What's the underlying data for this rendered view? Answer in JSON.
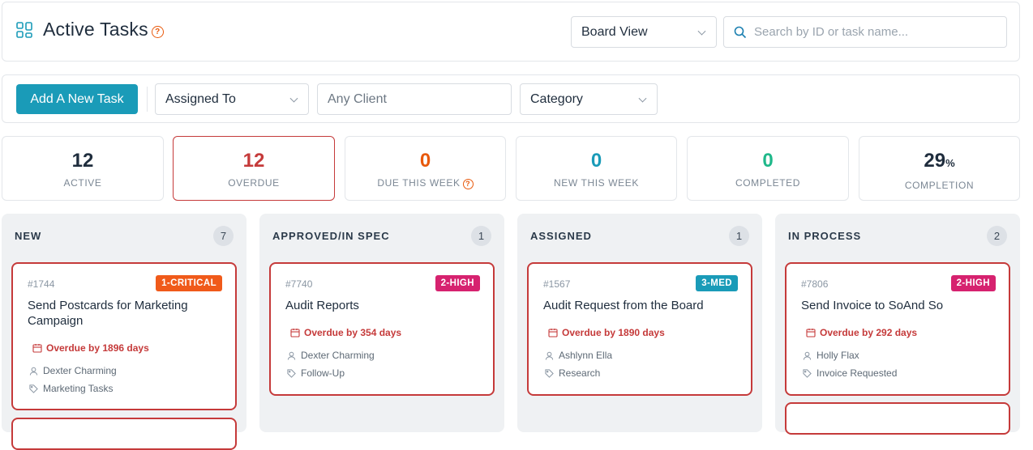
{
  "header": {
    "title": "Active Tasks",
    "view_select": "Board View",
    "search_placeholder": "Search by ID or task name..."
  },
  "filters": {
    "add_button": "Add A New Task",
    "assigned_to": "Assigned To",
    "client": "Any Client",
    "category": "Category"
  },
  "stats": [
    {
      "value": "12",
      "label": "ACTIVE",
      "color": "#1f2d3d"
    },
    {
      "value": "12",
      "label": "OVERDUE",
      "color": "#c53a3a"
    },
    {
      "value": "0",
      "label": "DUE THIS WEEK",
      "color": "#e8590c"
    },
    {
      "value": "0",
      "label": "NEW THIS WEEK",
      "color": "#1a9bb8"
    },
    {
      "value": "0",
      "label": "COMPLETED",
      "color": "#1fb88a"
    },
    {
      "value": "29",
      "unit": "%",
      "label": "COMPLETION",
      "color": "#1f2d3d"
    }
  ],
  "columns": [
    {
      "title": "NEW",
      "count": "7",
      "cards": [
        {
          "id": "#1744",
          "priority": "1-CRITICAL",
          "priority_color": "#f05a1a",
          "title": "Send Postcards for Marketing Campaign",
          "overdue": "Overdue by 1896 days",
          "assignee": "Dexter Charming",
          "tag": "Marketing Tasks"
        }
      ]
    },
    {
      "title": "APPROVED/IN SPEC",
      "count": "1",
      "cards": [
        {
          "id": "#7740",
          "priority": "2-HIGH",
          "priority_color": "#d6226f",
          "title": "Audit Reports",
          "overdue": "Overdue by 354 days",
          "assignee": "Dexter Charming",
          "tag": "Follow-Up"
        }
      ]
    },
    {
      "title": "ASSIGNED",
      "count": "1",
      "cards": [
        {
          "id": "#1567",
          "priority": "3-MED",
          "priority_color": "#1a9bb8",
          "title": "Audit Request from the Board",
          "overdue": "Overdue by 1890 days",
          "assignee": "Ashlynn Ella",
          "tag": "Research"
        }
      ]
    },
    {
      "title": "IN PROCESS",
      "count": "2",
      "cards": [
        {
          "id": "#7806",
          "priority": "2-HIGH",
          "priority_color": "#d6226f",
          "title": "Send Invoice to SoAnd So",
          "overdue": "Overdue by 292 days",
          "assignee": "Holly Flax",
          "tag": "Invoice Requested"
        }
      ]
    }
  ]
}
